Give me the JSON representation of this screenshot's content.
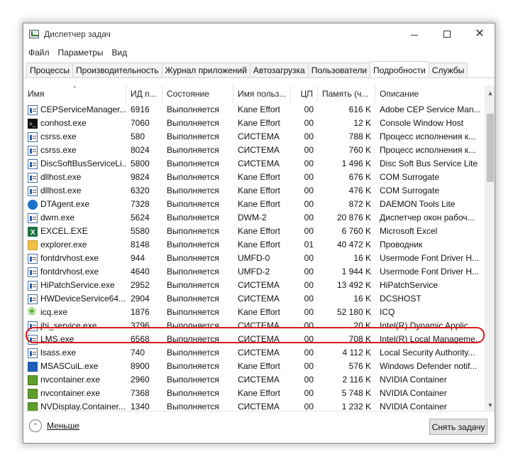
{
  "window": {
    "title": "Диспетчер задач",
    "app_icon": "task-manager-icon"
  },
  "menu": [
    "Файл",
    "Параметры",
    "Вид"
  ],
  "tabs": [
    {
      "label": "Процессы",
      "active": false
    },
    {
      "label": "Производительность",
      "active": false
    },
    {
      "label": "Журнал приложений",
      "active": false
    },
    {
      "label": "Автозагрузка",
      "active": false
    },
    {
      "label": "Пользователи",
      "active": false
    },
    {
      "label": "Подробности",
      "active": true
    },
    {
      "label": "Службы",
      "active": false
    }
  ],
  "columns": [
    "Имя",
    "ИД п...",
    "Состояние",
    "Имя польз...",
    "ЦП",
    "Память (ч...",
    "Описание"
  ],
  "rows": [
    {
      "icon": "std",
      "name": "CEPServiceManager....",
      "pid": "6916",
      "state": "Выполняется",
      "user": "Kane Effort",
      "cpu": "00",
      "mem": "616 K",
      "desc": "Adobe CEP Service Man..."
    },
    {
      "icon": "console",
      "name": "conhost.exe",
      "pid": "7060",
      "state": "Выполняется",
      "user": "Kane Effort",
      "cpu": "00",
      "mem": "12 K",
      "desc": "Console Window Host"
    },
    {
      "icon": "std",
      "name": "csrss.exe",
      "pid": "580",
      "state": "Выполняется",
      "user": "СИСТЕМА",
      "cpu": "00",
      "mem": "788 K",
      "desc": "Процесс исполнения к..."
    },
    {
      "icon": "std",
      "name": "csrss.exe",
      "pid": "8024",
      "state": "Выполняется",
      "user": "СИСТЕМА",
      "cpu": "00",
      "mem": "760 K",
      "desc": "Процесс исполнения к..."
    },
    {
      "icon": "std",
      "name": "DiscSoftBusServiceLi...",
      "pid": "5800",
      "state": "Выполняется",
      "user": "СИСТЕМА",
      "cpu": "00",
      "mem": "1 496 K",
      "desc": "Disc Soft Bus Service Lite"
    },
    {
      "icon": "std",
      "name": "dllhost.exe",
      "pid": "9824",
      "state": "Выполняется",
      "user": "Kane Effort",
      "cpu": "00",
      "mem": "676 K",
      "desc": "COM Surrogate"
    },
    {
      "icon": "std",
      "name": "dllhost.exe",
      "pid": "6320",
      "state": "Выполняется",
      "user": "Kane Effort",
      "cpu": "00",
      "mem": "476 K",
      "desc": "COM Surrogate"
    },
    {
      "icon": "daemon",
      "name": "DTAgent.exe",
      "pid": "7328",
      "state": "Выполняется",
      "user": "Kane Effort",
      "cpu": "00",
      "mem": "872 K",
      "desc": "DAEMON Tools Lite"
    },
    {
      "icon": "std",
      "name": "dwm.exe",
      "pid": "5624",
      "state": "Выполняется",
      "user": "DWM-2",
      "cpu": "00",
      "mem": "20 876 K",
      "desc": "Диспетчер окон рабоч..."
    },
    {
      "icon": "excel",
      "name": "EXCEL.EXE",
      "pid": "5580",
      "state": "Выполняется",
      "user": "Kane Effort",
      "cpu": "00",
      "mem": "6 760 K",
      "desc": "Microsoft Excel"
    },
    {
      "icon": "folder",
      "name": "explorer.exe",
      "pid": "8148",
      "state": "Выполняется",
      "user": "Kane Effort",
      "cpu": "01",
      "mem": "40 472 K",
      "desc": "Проводник"
    },
    {
      "icon": "std",
      "name": "fontdrvhost.exe",
      "pid": "944",
      "state": "Выполняется",
      "user": "UMFD-0",
      "cpu": "00",
      "mem": "16 K",
      "desc": "Usermode Font Driver H..."
    },
    {
      "icon": "std",
      "name": "fontdrvhost.exe",
      "pid": "4640",
      "state": "Выполняется",
      "user": "UMFD-2",
      "cpu": "00",
      "mem": "1 944 K",
      "desc": "Usermode Font Driver H..."
    },
    {
      "icon": "std",
      "name": "HiPatchService.exe",
      "pid": "2952",
      "state": "Выполняется",
      "user": "СИСТЕМА",
      "cpu": "00",
      "mem": "13 492 K",
      "desc": "HiPatchService"
    },
    {
      "icon": "std",
      "name": "HWDeviceService64....",
      "pid": "2904",
      "state": "Выполняется",
      "user": "СИСТЕМА",
      "cpu": "00",
      "mem": "16 K",
      "desc": "DCSHOST"
    },
    {
      "icon": "icq",
      "name": "icq.exe",
      "pid": "1876",
      "state": "Выполняется",
      "user": "Kane Effort",
      "cpu": "00",
      "mem": "52 180 K",
      "desc": "ICQ"
    },
    {
      "icon": "std",
      "name": "jhi_service.exe",
      "pid": "3796",
      "state": "Выполняется",
      "user": "СИСТЕМА",
      "cpu": "00",
      "mem": "20 K",
      "desc": "Intel(R) Dynamic Applic..."
    },
    {
      "icon": "std",
      "name": "LMS.exe",
      "pid": "6568",
      "state": "Выполняется",
      "user": "СИСТЕМА",
      "cpu": "00",
      "mem": "708 K",
      "desc": "Intel(R) Local Manageme..."
    },
    {
      "icon": "std",
      "name": "lsass.exe",
      "pid": "740",
      "state": "Выполняется",
      "user": "СИСТЕМА",
      "cpu": "00",
      "mem": "4 112 K",
      "desc": "Local Security Authority..."
    },
    {
      "icon": "defender",
      "name": "MSASCuiL.exe",
      "pid": "8900",
      "state": "Выполняется",
      "user": "Kane Effort",
      "cpu": "00",
      "mem": "576 K",
      "desc": "Windows Defender notif..."
    },
    {
      "icon": "nvidia",
      "name": "nvcontainer.exe",
      "pid": "2960",
      "state": "Выполняется",
      "user": "СИСТЕМА",
      "cpu": "00",
      "mem": "2 116 K",
      "desc": "NVIDIA Container"
    },
    {
      "icon": "nvidia",
      "name": "nvcontainer.exe",
      "pid": "7368",
      "state": "Выполняется",
      "user": "Kane Effort",
      "cpu": "00",
      "mem": "5 748 K",
      "desc": "NVIDIA Container"
    },
    {
      "icon": "nvidia",
      "name": "NVDisplay.Container...",
      "pid": "1340",
      "state": "Выполняется",
      "user": "СИСТЕМА",
      "cpu": "00",
      "mem": "1 232 K",
      "desc": "NVIDIA Container"
    }
  ],
  "highlighted_process": "icq.exe",
  "highlight_color": "#d9191d",
  "footer": {
    "less_label": "Меньше",
    "end_task_label": "Снять задачу"
  }
}
